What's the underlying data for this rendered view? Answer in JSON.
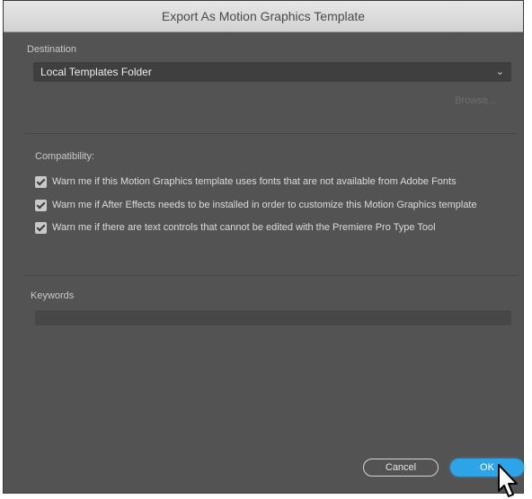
{
  "dialog": {
    "title": "Export As Motion Graphics Template"
  },
  "destination": {
    "label": "Destination",
    "selected": "Local Templates Folder",
    "browse_label": "Browse..."
  },
  "compatibility": {
    "label": "Compatibility:",
    "options": [
      {
        "label": "Warn me if this Motion Graphics template uses fonts that are not available from Adobe Fonts",
        "checked": true
      },
      {
        "label": "Warn me if After Effects needs to be installed in order to customize this Motion Graphics template",
        "checked": true
      },
      {
        "label": "Warn me if there are text controls that cannot be edited with the Premiere Pro Type Tool",
        "checked": true
      }
    ]
  },
  "keywords": {
    "label": "Keywords",
    "value": ""
  },
  "buttons": {
    "cancel_label": "Cancel",
    "ok_label": "OK"
  },
  "colors": {
    "dialog_bg": "#535353",
    "accent": "#2da3e8"
  }
}
